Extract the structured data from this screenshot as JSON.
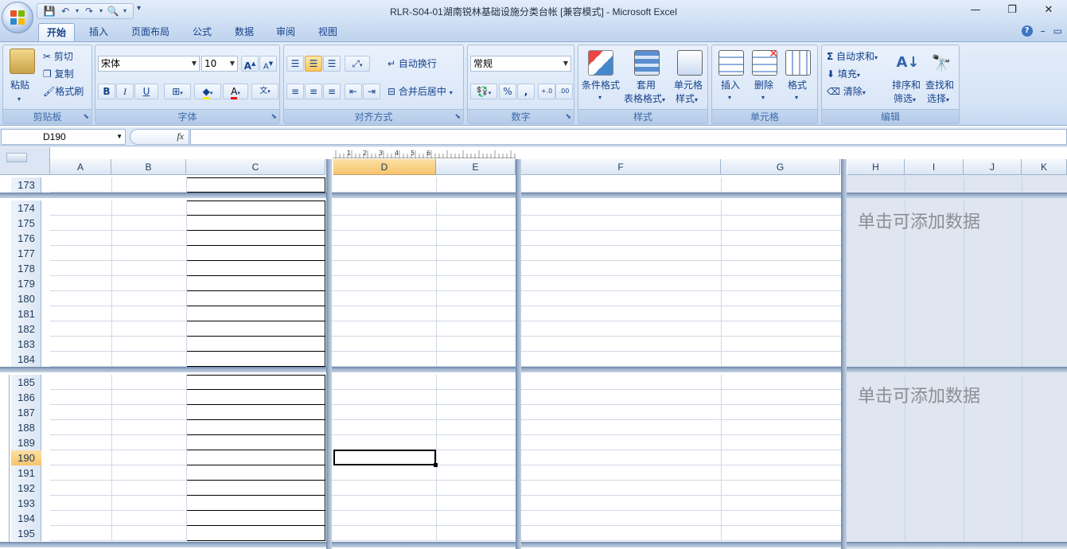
{
  "window": {
    "title": "RLR-S04-01湖南锐林基础设施分类台帐  [兼容模式] - Microsoft Excel",
    "controls": [
      "—",
      "❐",
      "✕"
    ]
  },
  "qat": {
    "icons": [
      "save-icon",
      "undo-icon",
      "redo-icon",
      "print-preview-icon",
      "customize-icon"
    ]
  },
  "tabs": [
    "开始",
    "插入",
    "页面布局",
    "公式",
    "数据",
    "审阅",
    "视图"
  ],
  "ribbon": {
    "clipboard": {
      "label": "剪贴板",
      "paste": "粘贴",
      "cut": "剪切",
      "copy": "复制",
      "format_painter": "格式刷"
    },
    "font": {
      "label": "字体",
      "font_name": "宋体",
      "font_size": "10",
      "bold": "B",
      "italic": "I",
      "underline": "U"
    },
    "alignment": {
      "label": "对齐方式",
      "wrap": "自动换行",
      "merge": "合并后居中"
    },
    "number": {
      "label": "数字",
      "format": "常规",
      "percent": "%",
      "comma": ","
    },
    "styles": {
      "label": "样式",
      "conditional": "条件格式",
      "table1": "套用",
      "table2": "表格格式",
      "cell1": "单元格",
      "cell2": "样式"
    },
    "cells": {
      "label": "单元格",
      "insert": "插入",
      "delete": "删除",
      "format": "格式"
    },
    "editing": {
      "label": "编辑",
      "autosum": "自动求和",
      "fill": "填充",
      "clear": "清除",
      "sort1": "排序和",
      "sort2": "筛选",
      "find1": "查找和",
      "find2": "选择"
    }
  },
  "formula_bar": {
    "name_box": "D190",
    "fx": "fx",
    "value": ""
  },
  "columns": [
    "A",
    "B",
    "C",
    "D",
    "E",
    "F",
    "G",
    "H",
    "I",
    "J",
    "K"
  ],
  "selected_column": "D",
  "rows_group1": [
    "173"
  ],
  "rows_group2": [
    "174",
    "175",
    "176",
    "177",
    "178",
    "179",
    "180",
    "181",
    "182",
    "183",
    "184"
  ],
  "rows_group3": [
    "185",
    "186",
    "187",
    "188",
    "189",
    "190",
    "191",
    "192",
    "193",
    "194",
    "195"
  ],
  "selected_row": "190",
  "page_hint": "单击可添加数据",
  "ruler": {
    "marks": [
      "1",
      "2",
      "3",
      "4",
      "5",
      "6"
    ]
  }
}
